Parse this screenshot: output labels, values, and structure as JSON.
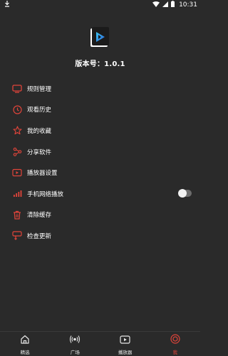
{
  "status_bar": {
    "time": "10:31"
  },
  "app": {
    "version_text": "版本号：1.0.1"
  },
  "menu": {
    "items": [
      {
        "label": "规则管理",
        "icon": "monitor-icon"
      },
      {
        "label": "观看历史",
        "icon": "clock-icon"
      },
      {
        "label": "我的收藏",
        "icon": "star-icon"
      },
      {
        "label": "分享软件",
        "icon": "share-icon"
      },
      {
        "label": "播放器设置",
        "icon": "player-settings-icon"
      },
      {
        "label": "手机网络播放",
        "icon": "signal-icon",
        "toggle": false
      },
      {
        "label": "清除缓存",
        "icon": "trash-icon"
      },
      {
        "label": "检查更新",
        "icon": "update-icon"
      }
    ]
  },
  "bottom_nav": {
    "tabs": [
      {
        "label": "精选",
        "icon": "home-icon",
        "active": false
      },
      {
        "label": "广场",
        "icon": "broadcast-icon",
        "active": false
      },
      {
        "label": "播放器",
        "icon": "play-icon",
        "active": false
      },
      {
        "label": "我",
        "icon": "me-icon",
        "active": true
      }
    ]
  },
  "colors": {
    "accent": "#e0443a",
    "background": "#2a2a2a"
  }
}
